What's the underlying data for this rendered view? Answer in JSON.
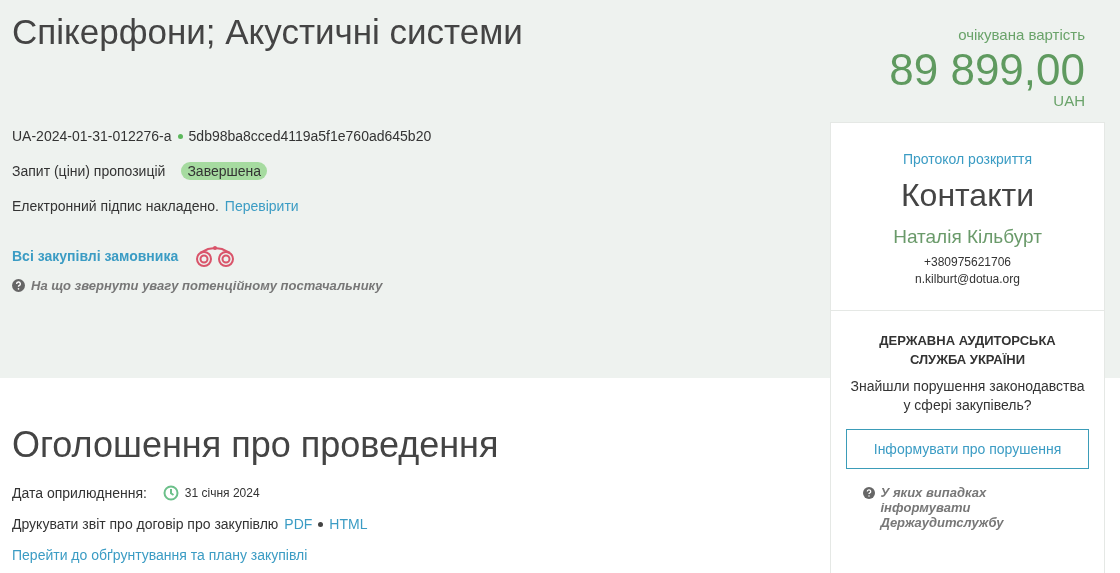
{
  "header": {
    "title": "Спікерфони; Акустичні системи",
    "tender_id": "UA-2024-01-31-012276-a",
    "hash": "5db98ba8cced4119a5f1e760ad645b20",
    "procedure": "Запит (ціни) пропозицій",
    "status": "Завершена",
    "signature_text": "Електронний підпис накладено.",
    "signature_link": "Перевірити",
    "buyer_link": "Всі закупівлі замовника",
    "hint": "На що звернути увагу потенційному постачальнику"
  },
  "price": {
    "label": "очікувана вартість",
    "amount": "89 899,00",
    "currency": "UAH"
  },
  "announcement": {
    "title": "Оголошення про проведення",
    "date_label": "Дата оприлюднення:",
    "date": "31 січня 2024",
    "print_text": "Друкувати звіт про договір про закупівлю",
    "print_links": [
      "PDF",
      "HTML"
    ],
    "plan_link": "Перейти до обґрунтування та плану закупівлі"
  },
  "contacts": {
    "protocol_link": "Протокол розкриття",
    "title": "Контакти",
    "name": "Наталія Кільбурт",
    "phone": "+380975621706",
    "email": "n.kilburt@dotua.org"
  },
  "audit": {
    "title": "ДЕРЖАВНА АУДИТОРСЬКА СЛУЖБА УКРАЇНИ",
    "question": "Знайшли порушення законодавства у сфері закупівель?",
    "button": "Інформувати про порушення",
    "hint": "У яких випадках інформувати Держаудитслужбу"
  }
}
